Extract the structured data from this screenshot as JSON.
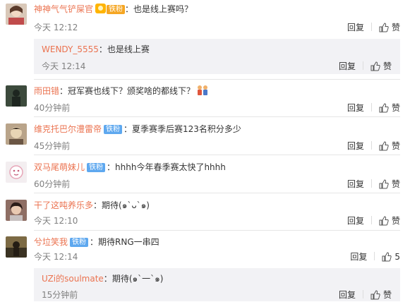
{
  "comments": [
    {
      "username": "神神气气铲屎官",
      "medal_badge": "铁粉",
      "text": "也是线上赛吗？",
      "time": "今天 12:12",
      "reply_label": "回复",
      "like_label": "赞",
      "reply": {
        "username": "WENDY_5555",
        "text": "也是线上赛",
        "time": "今天 12:14",
        "reply_label": "回复",
        "like_label": "赞"
      }
    },
    {
      "username": "雨田错",
      "text": "冠军赛也线下？颁奖啥的都线下？",
      "time": "40分钟前",
      "reply_label": "回复",
      "like_label": "赞"
    },
    {
      "username": "维克托巴尔澧雷帝",
      "badge": "铁粉",
      "text": "夏季赛季后赛123名积分多少",
      "time": "45分钟前",
      "reply_label": "回复",
      "like_label": "赞"
    },
    {
      "username": "双马尾萌妹儿",
      "badge": "铁粉",
      "text": "hhhh今年春季赛太快了hhhh",
      "time": "60分钟前",
      "reply_label": "回复",
      "like_label": "赞"
    },
    {
      "username": "干了这吨养乐多",
      "text": "期待(๑`ᴗ`๑)",
      "time": "今天 12:10",
      "reply_label": "回复",
      "like_label": "赞"
    },
    {
      "username": "兮垃笑我",
      "badge": "铁粉",
      "text": "期待RNG一串四",
      "time": "今天 12:14",
      "reply_label": "回复",
      "like_count": "5",
      "reply": {
        "username": "UZi的soulmate",
        "text": "期待(๑`一`๑)",
        "time": "15分钟前",
        "reply_label": "回复",
        "like_label": "赞"
      }
    }
  ],
  "colors": {
    "username": "#eb7350",
    "meta": "#808080",
    "badge": "#5ea8ef",
    "reply_bg": "#f2f2f5"
  },
  "icons": {
    "like": "thumbs-up-icon",
    "medal": "medal-icon"
  }
}
